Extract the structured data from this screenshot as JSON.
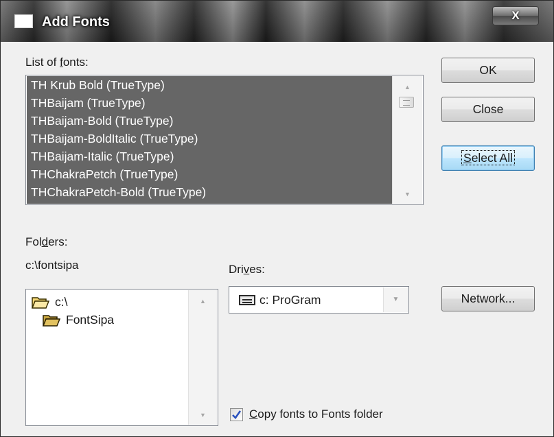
{
  "window": {
    "title": "Add Fonts",
    "close_glyph": "X"
  },
  "fonts_list": {
    "label_prefix": "List of ",
    "label_mnemonic": "f",
    "label_suffix": "onts:",
    "items": [
      "TH Krub Bold (TrueType)",
      "THBaijam (TrueType)",
      "THBaijam-Bold (TrueType)",
      "THBaijam-BoldItalic (TrueType)",
      "THBaijam-Italic (TrueType)",
      "THChakraPetch (TrueType)",
      "THChakraPetch-Bold (TrueType)"
    ],
    "selection_color": "#666666"
  },
  "buttons": {
    "ok": "OK",
    "close": "Close",
    "select_all_mnemonic": "S",
    "select_all_rest": "elect All",
    "network": "Network..."
  },
  "folders": {
    "label_prefix": "Fol",
    "label_mnemonic": "d",
    "label_suffix": "ers:",
    "current_path": "c:\\fontsipa",
    "tree": [
      {
        "name": "c:\\",
        "icon": "open-folder-icon"
      },
      {
        "name": "FontSipa",
        "icon": "open-folder-icon"
      }
    ]
  },
  "drives": {
    "label_prefix": "Dri",
    "label_mnemonic": "v",
    "label_suffix": "es:",
    "selected": "c: ProGram",
    "icon": "hard-drive-icon"
  },
  "copy_option": {
    "label_mnemonic": "C",
    "label_rest": "opy fonts to Fonts folder",
    "checked": true
  },
  "colors": {
    "dialog_bg": "#f0f0f0",
    "focus_button": "#bee6fd"
  }
}
